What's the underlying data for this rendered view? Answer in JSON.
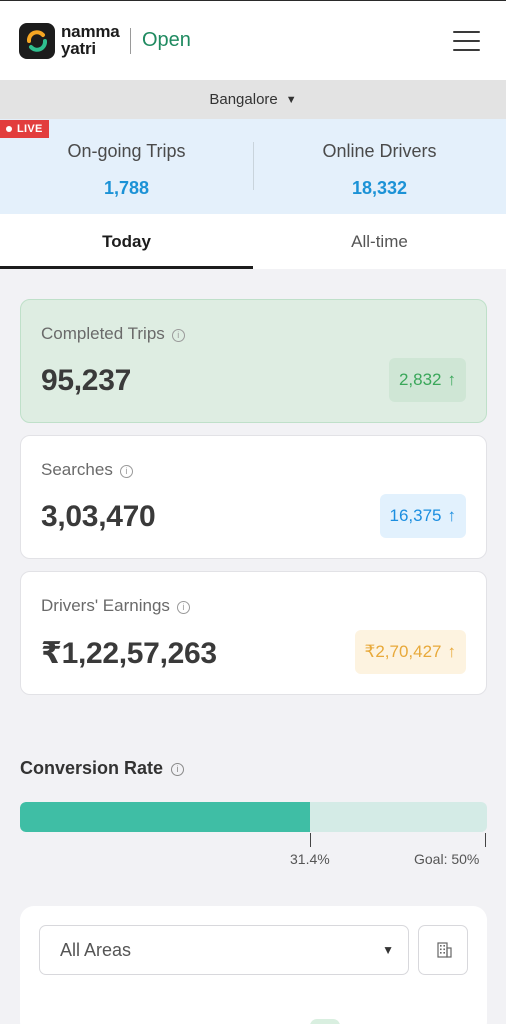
{
  "header": {
    "brand_line1": "namma",
    "brand_line2": "yatri",
    "open_label": "Open",
    "logo_icon": "namma-yatri-logo",
    "menu_icon": "hamburger-menu-icon"
  },
  "city_selector": {
    "selected": "Bangalore"
  },
  "live": {
    "badge": "LIVE",
    "ongoing_trips_label": "On-going Trips",
    "ongoing_trips_value": "1,788",
    "online_drivers_label": "Online Drivers",
    "online_drivers_value": "18,332"
  },
  "tabs": [
    {
      "label": "Today",
      "active": true
    },
    {
      "label": "All-time",
      "active": false
    }
  ],
  "metrics": [
    {
      "title": "Completed Trips",
      "value": "95,237",
      "delta": "2,832",
      "delta_color": "#3aa75a"
    },
    {
      "title": "Searches",
      "value": "3,03,470",
      "delta": "16,375",
      "delta_color": "#1b8ee0"
    },
    {
      "title": "Drivers' Earnings",
      "value": "₹1,22,57,263",
      "delta": "₹2,70,427",
      "delta_color": "#e8a93a"
    }
  ],
  "conversion": {
    "title": "Conversion Rate",
    "value_label": "31.4%",
    "goal_label": "Goal: 50%",
    "progress_fraction": 0.62,
    "fill_color": "#3fbea5",
    "track_color": "#d4ebe6"
  },
  "filter": {
    "area_selected": "All Areas",
    "city_button_icon": "building-icon"
  },
  "colors": {
    "brand_green": "#1f8a60",
    "live_red": "#e23d3d",
    "live_panel_bg": "#e4f0fb",
    "stat_blue": "#1b92d6"
  }
}
